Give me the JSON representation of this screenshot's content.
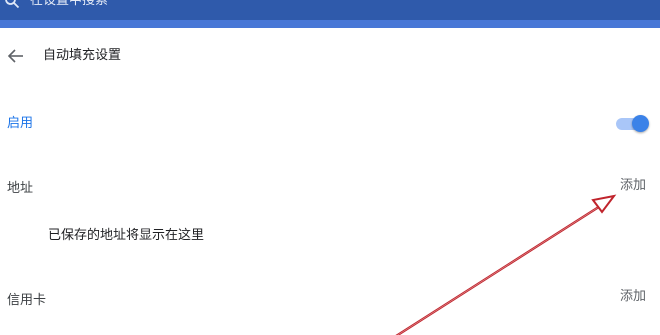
{
  "search": {
    "placeholder": "在设置中搜索"
  },
  "header": {
    "title": "自动填充设置"
  },
  "enable": {
    "label": "启用",
    "enabled": true
  },
  "address": {
    "label": "地址",
    "add_label": "添加",
    "empty_message": "已保存的地址将显示在这里"
  },
  "credit_card": {
    "label": "信用卡",
    "add_label": "添加"
  },
  "colors": {
    "header_bar": "#2f5aab",
    "accent": "#1a73e8",
    "toggle_on": "#3b82e8",
    "annotation_arrow": "#c0242c"
  }
}
